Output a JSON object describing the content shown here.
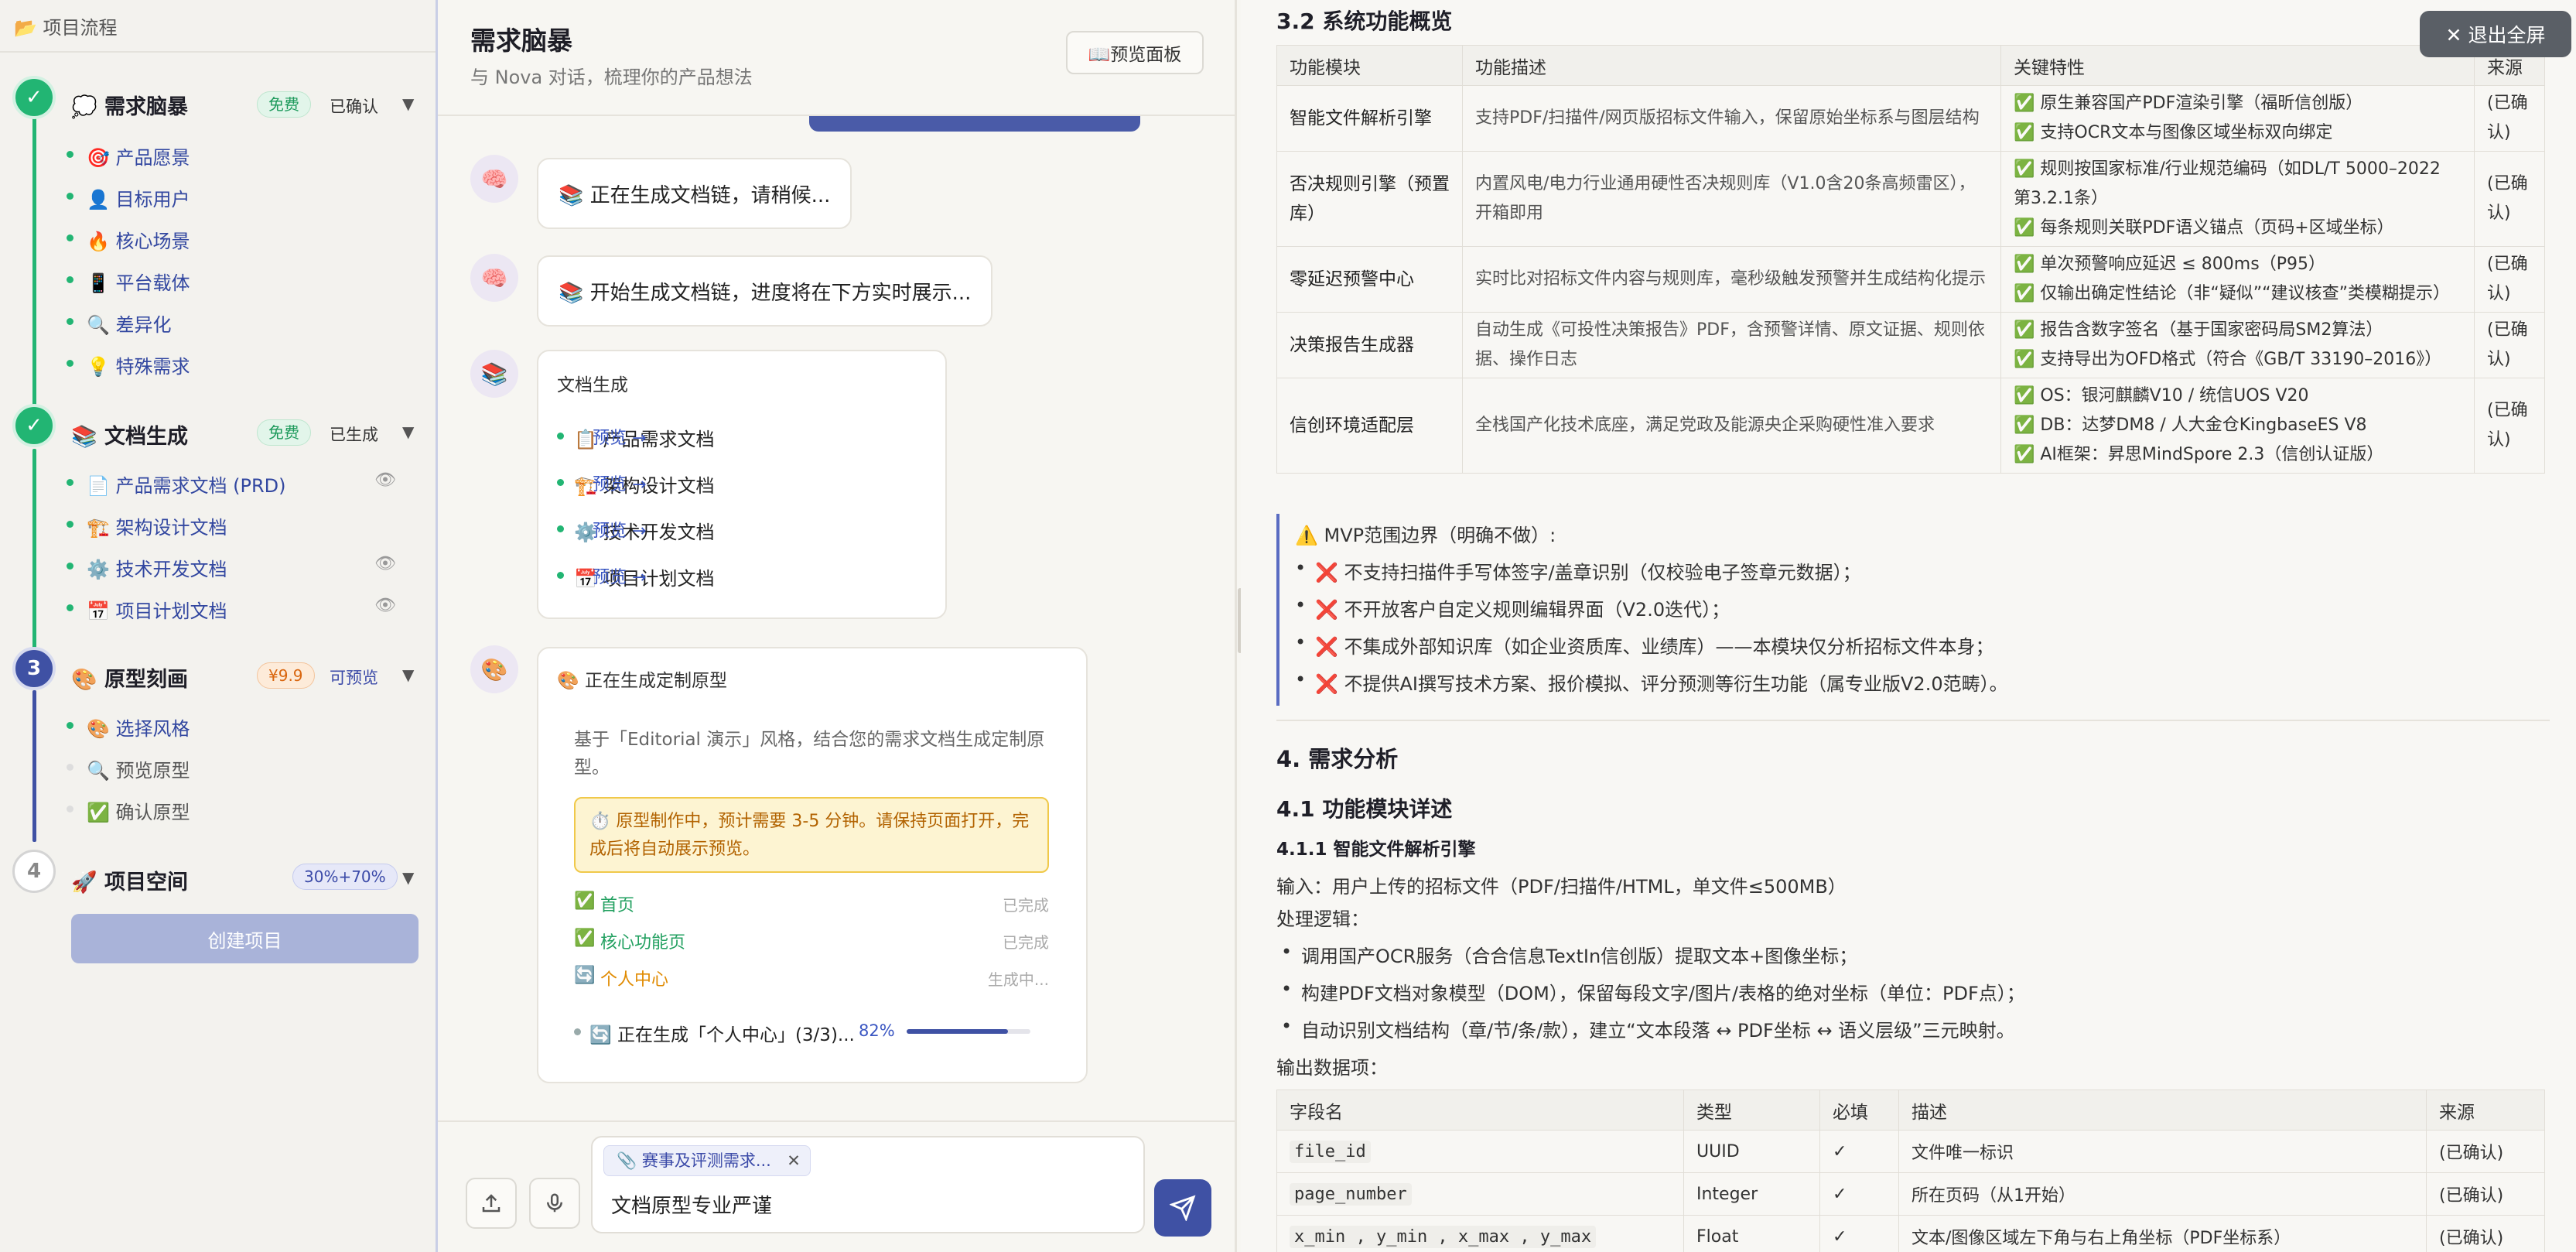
{
  "sidebar": {
    "title": "📂 项目流程",
    "create_button": "创建项目",
    "stages": [
      {
        "num": "✓",
        "icon": "💭",
        "title": "需求脑暴",
        "badge": "免费",
        "status": "已确认",
        "items": [
          "🎯 产品愿景",
          "👤 目标用户",
          "🔥 核心场景",
          "📱 平台载体",
          "🔍 差异化",
          "💡 特殊需求"
        ]
      },
      {
        "num": "✓",
        "icon": "📚",
        "title": "文档生成",
        "badge": "免费",
        "status": "已生成",
        "items": [
          "📄 产品需求文档 (PRD)",
          "🏗️ 架构设计文档",
          "⚙️ 技术开发文档",
          "📅 项目计划文档"
        ]
      },
      {
        "num": "3",
        "icon": "🎨",
        "title": "原型刻画",
        "badge": "¥9.9",
        "status": "可预览",
        "items": [
          "🎨 选择风格",
          "🔍 预览原型",
          "✅ 确认原型"
        ]
      },
      {
        "num": "4",
        "icon": "🚀",
        "title": "项目空间",
        "badge": "30%+70%",
        "status": "",
        "items": []
      }
    ]
  },
  "chat": {
    "title": "需求脑暴",
    "subtitle": "与 Nova 对话，梳理你的产品想法",
    "preview_button": "📖预览面板",
    "messages": [
      "📚 正在生成文档链，请稍候...",
      "📚 开始生成文档链，进度将在下方实时展示..."
    ],
    "docs_card": {
      "title": "文档生成",
      "preview_label": "预览 →",
      "docs": [
        "📋 产品需求文档",
        "🏗️ 架构设计文档",
        "⚙️ 技术开发文档",
        "📅 项目计划文档"
      ]
    },
    "proto_card": {
      "title": "🎨 正在生成定制原型",
      "desc": "基于「Editorial 演示」风格，结合您的需求文档生成定制原型。",
      "warning": "⏱️ 原型制作中，预计需要 3-5 分钟。请保持页面打开，完成后将自动展示预览。",
      "steps": [
        {
          "icon": "✅",
          "name": "首页",
          "state": "已完成"
        },
        {
          "icon": "✅",
          "name": "核心功能页",
          "state": "已完成"
        },
        {
          "icon": "🔄",
          "name": "个人中心",
          "state": "生成中..."
        }
      ],
      "progress_text": "🔄 正在生成「个人中心」(3/3)...",
      "progress_label": "82%",
      "progress_value": 0.82
    },
    "attachment": "📎 赛事及评测需求...",
    "attachment_close": "✕",
    "input_value": "文档原型专业严谨"
  },
  "doc": {
    "exit_fullscreen": "✕ 退出全屏",
    "section_32": "3.2 系统功能概览",
    "feature_table": {
      "headers": [
        "功能模块",
        "功能描述",
        "关键特性",
        "来源"
      ],
      "rows": [
        {
          "module": "智能文件解析引擎",
          "desc": "支持PDF/扫描件/网页版招标文件输入，保留原始坐标系与图层结构",
          "features": [
            "✅ 原生兼容国产PDF渲染引擎（福昕信创版）",
            "✅ 支持OCR文本与图像区域坐标双向绑定"
          ],
          "source": "(已确认)"
        },
        {
          "module": "否决规则引擎（预置库）",
          "desc": "内置风电/电力行业通用硬性否决规则库（V1.0含20条高频雷区），开箱即用",
          "features": [
            "✅ 规则按国家标准/行业规范编码（如DL/T 5000–2022 第3.2.1条）",
            "✅ 每条规则关联PDF语义锚点（页码+区域坐标）"
          ],
          "source": "(已确认)"
        },
        {
          "module": "零延迟预警中心",
          "desc": "实时比对招标文件内容与规则库，毫秒级触发预警并生成结构化提示",
          "features": [
            "✅ 单次预警响应延迟 ≤ 800ms（P95）",
            "✅ 仅输出确定性结论（非“疑似”“建议核查”类模糊提示）"
          ],
          "source": "(已确认)"
        },
        {
          "module": "决策报告生成器",
          "desc": "自动生成《可投性决策报告》PDF，含预警详情、原文证据、规则依据、操作日志",
          "features": [
            "✅ 报告含数字签名（基于国家密码局SM2算法）",
            "✅ 支持导出为OFD格式（符合《GB/T 33190–2016》）"
          ],
          "source": "(已确认)"
        },
        {
          "module": "信创环境适配层",
          "desc": "全栈国产化技术底座，满足党政及能源央企采购硬性准入要求",
          "features": [
            "✅ OS：银河麒麟V10 / 统信UOS V20",
            "✅ DB：达梦DM8 / 人大金仓KingbaseES V8",
            "✅ AI框架：昇思MindSpore 2.3（信创认证版）"
          ],
          "source": "(已确认)"
        }
      ]
    },
    "mvp": {
      "title": "⚠️ MVP范围边界（明确不做）:",
      "items": [
        "❌ 不支持扫描件手写体签字/盖章识别（仅校验电子签章元数据）；",
        "❌ 不开放客户自定义规则编辑界面（V2.0迭代）；",
        "❌ 不集成外部知识库（如企业资质库、业绩库）——本模块仅分析招标文件本身；",
        "❌ 不提供AI撰写技术方案、报价模拟、评分预测等衍生功能（属专业版V2.0范畴）。"
      ]
    },
    "section_4": "4. 需求分析",
    "section_41": "4.1 功能模块详述",
    "section_411": "4.1.1 智能文件解析引擎",
    "input_line": "输入：用户上传的招标文件（PDF/扫描件/HTML，单文件≤500MB）",
    "logic_title": "处理逻辑：",
    "logic_items": [
      "调用国产OCR服务（合合信息TextIn信创版）提取文本+图像坐标；",
      "构建PDF文档对象模型（DOM），保留每段文字/图片/表格的绝对坐标（单位：PDF点）；",
      "自动识别文档结构（章/节/条/款），建立“文本段落 ↔ PDF坐标 ↔ 语义层级”三元映射。"
    ],
    "output_title": "输出数据项：",
    "output_table": {
      "headers": [
        "字段名",
        "类型",
        "必填",
        "描述",
        "来源"
      ],
      "rows": [
        {
          "field": "file_id",
          "type": "UUID",
          "req": "✓",
          "desc": "文件唯一标识",
          "source": "(已确认)"
        },
        {
          "field": "page_number",
          "type": "Integer",
          "req": "✓",
          "desc": "所在页码（从1开始）",
          "source": "(已确认)"
        },
        {
          "field": "x_min , y_min , x_max , y_max",
          "type": "Float",
          "req": "✓",
          "desc": "文本/图像区域左下角与右上角坐标（PDF坐标系）",
          "source": "(已确认)"
        }
      ]
    }
  }
}
